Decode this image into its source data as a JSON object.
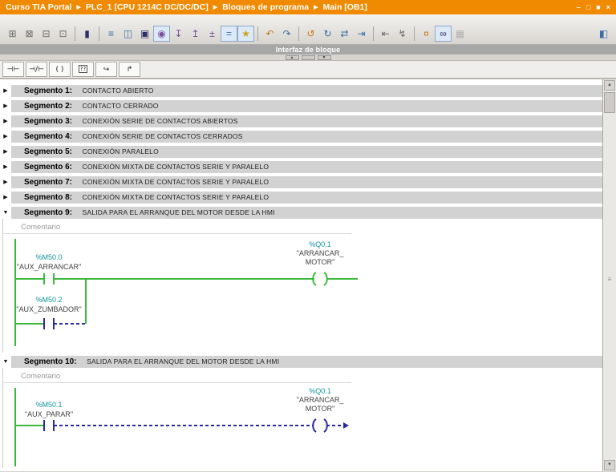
{
  "title_bar": {
    "items": [
      "Curso TIA Portal",
      "PLC_1 [CPU 1214C DC/DC/DC]",
      "Bloques de programa",
      "Main [OB1]"
    ],
    "separator": "▶",
    "window_controls": [
      {
        "name": "minimize",
        "glyph": "–"
      },
      {
        "name": "restore",
        "glyph": "□"
      },
      {
        "name": "maximize",
        "glyph": "■"
      },
      {
        "name": "close",
        "glyph": "×"
      }
    ]
  },
  "toolbar": {
    "items": [
      {
        "name": "insert-network",
        "glyph": "⊞"
      },
      {
        "name": "delete-network",
        "glyph": "⊠"
      },
      {
        "name": "insert-row",
        "glyph": "⊟"
      },
      {
        "name": "insert-column",
        "glyph": "⊡"
      },
      {
        "name": "insert-block-call",
        "glyph": "▮"
      },
      {
        "name": "absolute-operands-toggle",
        "glyph": "≡"
      },
      {
        "name": "open-all-networks",
        "glyph": "◫"
      },
      {
        "name": "close-all-networks",
        "glyph": "▣"
      },
      {
        "name": "network-comments-toggle",
        "glyph": "◉"
      },
      {
        "name": "expand-ladder-down",
        "glyph": "↧"
      },
      {
        "name": "collapse-ladder-up",
        "glyph": "↥"
      },
      {
        "name": "expand-collapse-operands",
        "glyph": "±"
      },
      {
        "name": "symbol-information-toggle",
        "glyph": "="
      },
      {
        "name": "favorites-visibility-toggle",
        "glyph": "★"
      },
      {
        "name": "undo",
        "glyph": "↶"
      },
      {
        "name": "redo",
        "glyph": "↷"
      },
      {
        "name": "go-to-previous-error",
        "glyph": "↺"
      },
      {
        "name": "go-to-next-error",
        "glyph": "↻"
      },
      {
        "name": "update-block-calls",
        "glyph": "⇄"
      },
      {
        "name": "consistency-check",
        "glyph": "⇥"
      },
      {
        "name": "go-to-definition",
        "glyph": "⇤"
      },
      {
        "name": "go-to-usage",
        "glyph": "↯"
      },
      {
        "name": "search-in-block",
        "glyph": "¤"
      },
      {
        "name": "monitoring-toggle",
        "glyph": "∞"
      },
      {
        "name": "snapshot",
        "glyph": "▦"
      },
      {
        "name": "editor-layout",
        "glyph": "◧"
      }
    ]
  },
  "panel_bar": {
    "label": "Interfaz de bloque"
  },
  "splitter": {
    "up": "▲",
    "down": "▼"
  },
  "favorites": {
    "items": [
      {
        "name": "no-contact",
        "label": "⊣⊢"
      },
      {
        "name": "nc-contact",
        "label": "⊣/⊢"
      },
      {
        "name": "coil",
        "label": "( )"
      },
      {
        "name": "empty-box",
        "label": "??"
      },
      {
        "name": "open-branch",
        "label": "↪"
      },
      {
        "name": "close-branch",
        "label": "↱"
      }
    ]
  },
  "segments": [
    {
      "tri": "▶",
      "num": "Segmento 1:",
      "title": "CONTACTO ABIERTO"
    },
    {
      "tri": "▶",
      "num": "Segmento 2:",
      "title": "CONTACTO CERRADO"
    },
    {
      "tri": "▶",
      "num": "Segmento 3:",
      "title": "CONEXIÓN SERIE DE CONTACTOS ABIERTOS"
    },
    {
      "tri": "▶",
      "num": "Segmento 4:",
      "title": "CONEXIÓN SERIE DE CONTACTOS CERRADOS"
    },
    {
      "tri": "▶",
      "num": "Segmento 5:",
      "title": "CONEXIÓN PARALELO"
    },
    {
      "tri": "▶",
      "num": "Segmento 6:",
      "title": "CONEXIÓN MIXTA DE CONTACTOS SERIE Y PARALELO"
    },
    {
      "tri": "▶",
      "num": "Segmento 7:",
      "title": "CONEXIÓN MIXTA DE CONTACTOS SERIE Y PARALELO"
    },
    {
      "tri": "▶",
      "num": "Segmento 8:",
      "title": "CONEXIÓN MIXTA DE CONTACTOS SERIE Y PARALELO"
    },
    {
      "tri": "▼",
      "num": "Segmento 9:",
      "title": "SALIDA PARA EL ARRANQUE DEL MOTOR DESDE LA HMI",
      "comment": "Comentario"
    },
    {
      "tri": "▼",
      "num": "Segmento 10:",
      "title": "SALIDA PARA EL ARRANQUE DEL MOTOR DESDE LA HMI",
      "comment": "Comentario"
    }
  ],
  "ladder9": {
    "contact": {
      "address": "%M50.0",
      "name": "\"AUX_ARRANCAR\""
    },
    "branch": {
      "address": "%M50.2",
      "name": "\"AUX_ZUMBADOR\""
    },
    "coil": {
      "address": "%Q0.1",
      "name1": "\"ARRANCAR_",
      "name2": "MOTOR\""
    }
  },
  "ladder10": {
    "contact": {
      "address": "%M50.1",
      "name": "\"AUX_PARAR\""
    },
    "coil": {
      "address": "%Q0.1",
      "name1": "\"ARRANCAR_",
      "name2": "MOTOR\""
    }
  },
  "scrollbar": {
    "up": "▲",
    "down": "▼",
    "grip": "≡"
  },
  "colors": {
    "title_bar_bg": "#F08A00",
    "ladder_green": "#3CB83C",
    "operand_teal": "#12929B",
    "incomplete_navy": "#2A2AA0",
    "segment_bar_gray": "#D2D2D2"
  }
}
